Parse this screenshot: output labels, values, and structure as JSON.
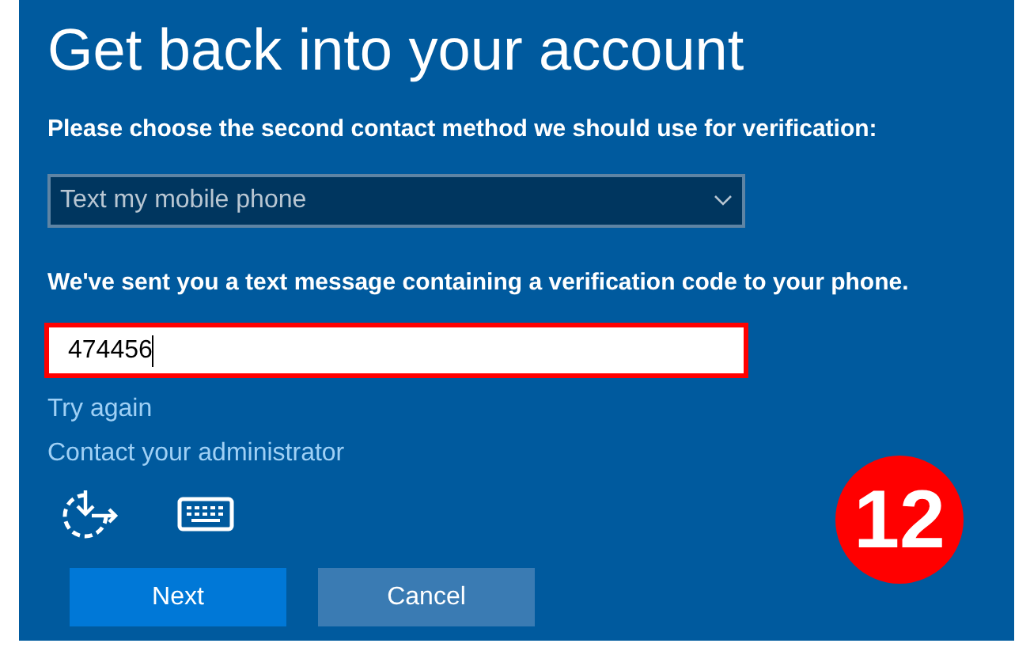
{
  "title": "Get back into your account",
  "method": {
    "label": "Please choose the second contact method we should use for verification:",
    "value": "Text my mobile phone"
  },
  "code": {
    "label": "We've sent you a text message containing a verification code to your phone.",
    "value": "474456",
    "highlighted": true
  },
  "links": [
    "Try again",
    "Contact your administrator"
  ],
  "buttons": [
    {
      "label": "Next",
      "kind": "primary"
    },
    {
      "label": "Cancel",
      "kind": "secondary"
    }
  ],
  "step_badge": "12"
}
